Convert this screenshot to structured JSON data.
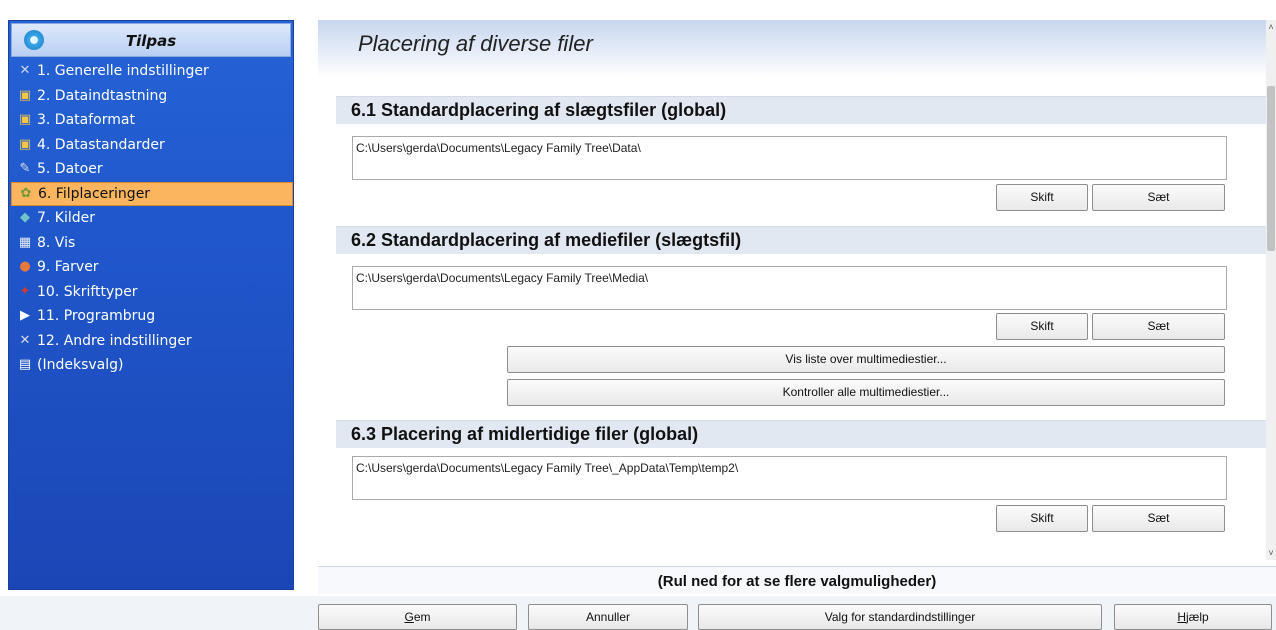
{
  "sidebar": {
    "title": "Tilpas",
    "items": [
      {
        "label": "1. Generelle indstillinger",
        "icon": "tools-icon",
        "glyph": "✕",
        "color": "#cfd8e6"
      },
      {
        "label": "2. Dataindtastning",
        "icon": "data-entry-icon",
        "glyph": "▣",
        "color": "#f1c64b"
      },
      {
        "label": "3. Dataformat",
        "icon": "data-format-icon",
        "glyph": "▣",
        "color": "#f1c64b"
      },
      {
        "label": "4. Datastandarder",
        "icon": "data-standards-icon",
        "glyph": "▣",
        "color": "#f1c64b"
      },
      {
        "label": "5. Datoer",
        "icon": "calendar-icon",
        "glyph": "✎",
        "color": "#d8dde5"
      },
      {
        "label": "6. Filplaceringer",
        "icon": "file-locations-icon",
        "glyph": "✿",
        "color": "#6d9a3a",
        "selected": true
      },
      {
        "label": "7. Kilder",
        "icon": "sources-icon",
        "glyph": "◆",
        "color": "#6fc3c9"
      },
      {
        "label": "8. Vis",
        "icon": "view-icon",
        "glyph": "▦",
        "color": "#e9eef6"
      },
      {
        "label": "9. Farver",
        "icon": "colors-icon",
        "glyph": "●",
        "color": "#e8793a"
      },
      {
        "label": "10. Skrifttyper",
        "icon": "fonts-icon",
        "glyph": "✦",
        "color": "#d23b2b"
      },
      {
        "label": "11. Programbrug",
        "icon": "play-icon",
        "glyph": "▶",
        "color": "#ffffff"
      },
      {
        "label": "12. Andre indstillinger",
        "icon": "other-settings-icon",
        "glyph": "✕",
        "color": "#d7dce6"
      },
      {
        "label": "(Indeksvalg)",
        "icon": "document-icon",
        "glyph": "▤",
        "color": "#ffffff"
      }
    ]
  },
  "main": {
    "title": "Placering af diverse filer",
    "sections": [
      {
        "title": "6.1  Standardplacering af slægtsfiler (global)",
        "path": "C:\\Users\\gerda\\Documents\\Legacy Family Tree\\Data\\"
      },
      {
        "title": "6.2  Standardplacering af mediefiler (slægtsfil)",
        "path": "C:\\Users\\gerda\\Documents\\Legacy Family Tree\\Media\\"
      },
      {
        "title": "6.3  Placering af midlertidige filer (global)",
        "path": "C:\\Users\\gerda\\Documents\\Legacy Family Tree\\_AppData\\Temp\\temp2\\"
      }
    ],
    "change_label": "Skift",
    "set_label": "Sæt",
    "show_media_list_label": "Vis liste over multimediestier...",
    "check_media_label": "Kontroller alle multimediestier..."
  },
  "hint": "(Rul ned for at se flere valgmuligheder)",
  "bottom": {
    "save_rest": "em",
    "save_underline": "G",
    "cancel": "Annuller",
    "defaults": "Valg for standardindstillinger",
    "help_underline": "H",
    "help_rest": "jælp"
  },
  "scrollbar": {
    "up": "˄",
    "down": "˅"
  }
}
